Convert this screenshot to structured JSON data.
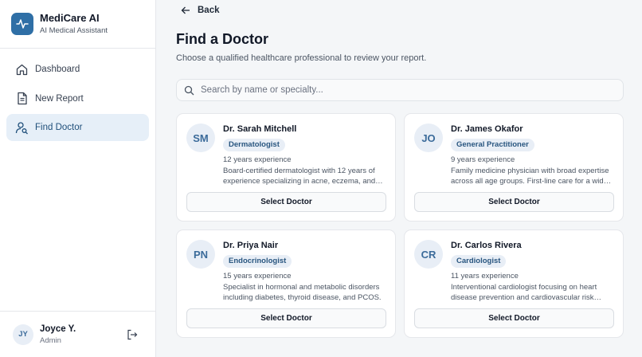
{
  "brand": {
    "title": "MediCare AI",
    "subtitle": "AI Medical Assistant",
    "color": "#2f6fa6"
  },
  "nav": [
    {
      "label": "Dashboard",
      "icon": "home-icon",
      "active": false
    },
    {
      "label": "New Report",
      "icon": "document-icon",
      "active": false
    },
    {
      "label": "Find Doctor",
      "icon": "user-search-icon",
      "active": true
    }
  ],
  "user": {
    "initials": "JY",
    "name": "Joyce Y.",
    "role": "Admin"
  },
  "page": {
    "back_label": "Back",
    "title": "Find a Doctor",
    "subtitle": "Choose a qualified healthcare professional to review your report.",
    "search_placeholder": "Search by name or specialty..."
  },
  "doctors": [
    {
      "initials": "SM",
      "name": "Dr. Sarah Mitchell",
      "specialty": "Dermatologist",
      "experience": "12 years experience",
      "bio": "Board-certified dermatologist with 12 years of experience specializing in acne, eczema, and psoriasis.",
      "button": "Select Doctor"
    },
    {
      "initials": "JO",
      "name": "Dr. James Okafor",
      "specialty": "General Practitioner",
      "experience": "9 years experience",
      "bio": "Family medicine physician with broad expertise across all age groups. First-line care for a wide range of conditions.",
      "button": "Select Doctor"
    },
    {
      "initials": "PN",
      "name": "Dr. Priya Nair",
      "specialty": "Endocrinologist",
      "experience": "15 years experience",
      "bio": "Specialist in hormonal and metabolic disorders including diabetes, thyroid disease, and PCOS.",
      "button": "Select Doctor"
    },
    {
      "initials": "CR",
      "name": "Dr. Carlos Rivera",
      "specialty": "Cardiologist",
      "experience": "11 years experience",
      "bio": "Interventional cardiologist focusing on heart disease prevention and cardiovascular risk management.",
      "button": "Select Doctor"
    }
  ]
}
